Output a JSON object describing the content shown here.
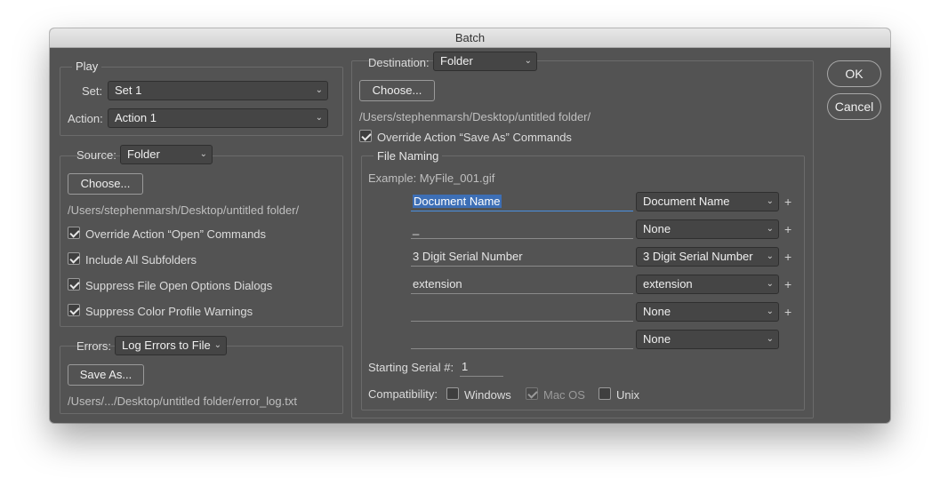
{
  "window": {
    "title": "Batch"
  },
  "actions": {
    "ok_label": "OK",
    "cancel_label": "Cancel"
  },
  "play": {
    "legend": "Play",
    "set_label": "Set:",
    "set_value": "Set 1",
    "action_label": "Action:",
    "action_value": "Action 1"
  },
  "source": {
    "label": "Source:",
    "value": "Folder",
    "choose_label": "Choose...",
    "path": "/Users/stephenmarsh/Desktop/untitled folder/",
    "checkboxes": [
      {
        "label": "Override Action “Open” Commands",
        "checked": true
      },
      {
        "label": "Include All Subfolders",
        "checked": true
      },
      {
        "label": "Suppress File Open Options Dialogs",
        "checked": true
      },
      {
        "label": "Suppress Color Profile Warnings",
        "checked": true
      }
    ]
  },
  "errors": {
    "label": "Errors:",
    "value": "Log Errors to File",
    "save_as_label": "Save As...",
    "path": "/Users/.../Desktop/untitled folder/error_log.txt"
  },
  "destination": {
    "label": "Destination:",
    "value": "Folder",
    "choose_label": "Choose...",
    "path": "/Users/stephenmarsh/Desktop/untitled folder/",
    "override_label": "Override Action “Save As” Commands",
    "override_checked": true
  },
  "file_naming": {
    "legend": "File Naming",
    "example": "Example: MyFile_001.gif",
    "rows": [
      {
        "field": "Document Name",
        "select": "Document Name",
        "plus": "+"
      },
      {
        "field": "_",
        "select": "None",
        "plus": "+"
      },
      {
        "field": "3 Digit Serial Number",
        "select": "3 Digit Serial Number",
        "plus": "+"
      },
      {
        "field": "extension",
        "select": "extension",
        "plus": "+"
      },
      {
        "field": "",
        "select": "None",
        "plus": "+"
      },
      {
        "field": "",
        "select": "None",
        "plus": ""
      }
    ],
    "serial_label": "Starting Serial #:",
    "serial_value": "1",
    "compat_label": "Compatibility:",
    "compat": [
      {
        "label": "Windows",
        "checked": false,
        "disabled": false
      },
      {
        "label": "Mac OS",
        "checked": true,
        "disabled": true
      },
      {
        "label": "Unix",
        "checked": false,
        "disabled": false
      }
    ]
  }
}
